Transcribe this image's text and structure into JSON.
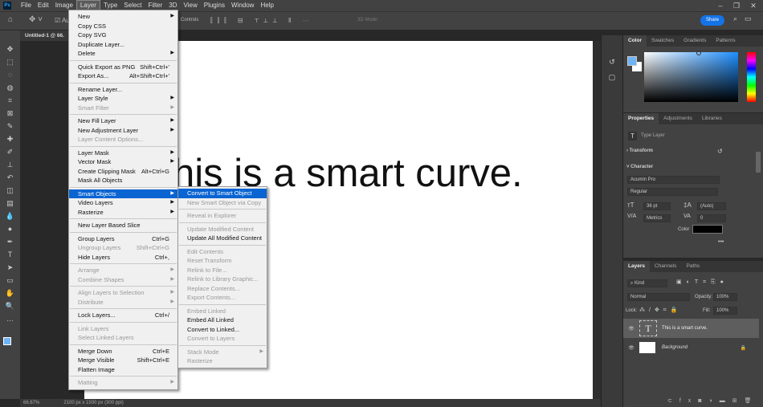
{
  "menubar": {
    "logo": "Ps",
    "items": [
      "File",
      "Edit",
      "Image",
      "Layer",
      "Type",
      "Select",
      "Filter",
      "3D",
      "View",
      "Plugins",
      "Window",
      "Help"
    ],
    "active": "Layer"
  },
  "options": {
    "auto_label": "Au",
    "controls_label": "Controls",
    "mode_label": "3D Mode:"
  },
  "share_label": "Share",
  "document": {
    "tab": "Untitled-1 @ 66.",
    "canvas_text": "his is a smart curve.",
    "zoom": "66.67%",
    "size": "2100 px x 1500 px (300 ppi)"
  },
  "toolbar_icons": [
    "move-icon",
    "marquee-icon",
    "lasso-icon",
    "quick-select-icon",
    "crop-icon",
    "frame-icon",
    "eyedropper-icon",
    "healing-icon",
    "brush-icon",
    "stamp-icon",
    "history-brush-icon",
    "eraser-icon",
    "gradient-icon",
    "blur-icon",
    "dodge-icon",
    "pen-icon",
    "type-icon",
    "path-select-icon",
    "shape-icon",
    "hand-icon",
    "zoom-icon",
    "more-icon"
  ],
  "toolbar_glyphs": [
    "✥",
    "⬚",
    "◌",
    "◍",
    "⌗",
    "⊠",
    "✎",
    "✚",
    "✐",
    "⊥",
    "↶",
    "◫",
    "▤",
    "💧",
    "●",
    "✒",
    "T",
    "➤",
    "▭",
    "✋",
    "🔍",
    "…"
  ],
  "layer_menu": [
    {
      "label": "New",
      "arrow": true
    },
    {
      "label": "Copy CSS"
    },
    {
      "label": "Copy SVG"
    },
    {
      "label": "Duplicate Layer..."
    },
    {
      "label": "Delete",
      "arrow": true
    },
    {
      "sep": true
    },
    {
      "label": "Quick Export as PNG",
      "shortcut": "Shift+Ctrl+'"
    },
    {
      "label": "Export As...",
      "shortcut": "Alt+Shift+Ctrl+'"
    },
    {
      "sep": true
    },
    {
      "label": "Rename Layer..."
    },
    {
      "label": "Layer Style",
      "arrow": true
    },
    {
      "label": "Smart Filter",
      "arrow": true,
      "disabled": true
    },
    {
      "sep": true
    },
    {
      "label": "New Fill Layer",
      "arrow": true
    },
    {
      "label": "New Adjustment Layer",
      "arrow": true
    },
    {
      "label": "Layer Content Options...",
      "disabled": true
    },
    {
      "sep": true
    },
    {
      "label": "Layer Mask",
      "arrow": true
    },
    {
      "label": "Vector Mask",
      "arrow": true
    },
    {
      "label": "Create Clipping Mask",
      "shortcut": "Alt+Ctrl+G"
    },
    {
      "label": "Mask All Objects"
    },
    {
      "sep": true
    },
    {
      "label": "Smart Objects",
      "arrow": true,
      "highlighted": true
    },
    {
      "label": "Video Layers",
      "arrow": true
    },
    {
      "label": "Rasterize",
      "arrow": true
    },
    {
      "sep": true
    },
    {
      "label": "New Layer Based Slice"
    },
    {
      "sep": true
    },
    {
      "label": "Group Layers",
      "shortcut": "Ctrl+G"
    },
    {
      "label": "Ungroup Layers",
      "shortcut": "Shift+Ctrl+G",
      "disabled": true
    },
    {
      "label": "Hide Layers",
      "shortcut": "Ctrl+,"
    },
    {
      "sep": true
    },
    {
      "label": "Arrange",
      "arrow": true,
      "disabled": true
    },
    {
      "label": "Combine Shapes",
      "arrow": true,
      "disabled": true
    },
    {
      "sep": true
    },
    {
      "label": "Align Layers to Selection",
      "arrow": true,
      "disabled": true
    },
    {
      "label": "Distribute",
      "arrow": true,
      "disabled": true
    },
    {
      "sep": true
    },
    {
      "label": "Lock Layers...",
      "shortcut": "Ctrl+/"
    },
    {
      "sep": true
    },
    {
      "label": "Link Layers",
      "disabled": true
    },
    {
      "label": "Select Linked Layers",
      "disabled": true
    },
    {
      "sep": true
    },
    {
      "label": "Merge Down",
      "shortcut": "Ctrl+E"
    },
    {
      "label": "Merge Visible",
      "shortcut": "Shift+Ctrl+E"
    },
    {
      "label": "Flatten Image"
    },
    {
      "sep": true
    },
    {
      "label": "Matting",
      "arrow": true,
      "disabled": true
    }
  ],
  "smart_objects_menu": [
    {
      "label": "Convert to Smart Object",
      "highlighted": true
    },
    {
      "label": "New Smart Object via Copy",
      "disabled": true
    },
    {
      "sep": true
    },
    {
      "label": "Reveal in Explorer",
      "disabled": true
    },
    {
      "sep": true
    },
    {
      "label": "Update Modified Content",
      "disabled": true
    },
    {
      "label": "Update All Modified Content"
    },
    {
      "sep": true
    },
    {
      "label": "Edit Contents",
      "disabled": true
    },
    {
      "label": "Reset Transform",
      "disabled": true
    },
    {
      "label": "Relink to File...",
      "disabled": true
    },
    {
      "label": "Relink to Library Graphic...",
      "disabled": true
    },
    {
      "label": "Replace Contents...",
      "disabled": true
    },
    {
      "label": "Export Contents...",
      "disabled": true
    },
    {
      "sep": true
    },
    {
      "label": "Embed Linked",
      "disabled": true
    },
    {
      "label": "Embed All Linked"
    },
    {
      "label": "Convert to Linked..."
    },
    {
      "label": "Convert to Layers",
      "disabled": true
    },
    {
      "sep": true
    },
    {
      "label": "Stack Mode",
      "arrow": true,
      "disabled": true
    },
    {
      "label": "Rasterize",
      "disabled": true
    }
  ],
  "color_panel": {
    "tabs": [
      "Color",
      "Swatches",
      "Gradients",
      "Patterns"
    ],
    "foreground": "#6fb4f5",
    "background": "#ffffff"
  },
  "properties": {
    "tabs": [
      "Properties",
      "Adjustments",
      "Libraries"
    ],
    "kind": "Type Layer",
    "transform": "Transform",
    "character": "Character",
    "font": "Acumin Pro",
    "style": "Regular",
    "size": "36 pt",
    "leading": "(Auto)",
    "kerning": "Metrics",
    "tracking": "0",
    "color_label": "Color",
    "color": "#000000"
  },
  "layers": {
    "tabs": [
      "Layers",
      "Channels",
      "Paths"
    ],
    "filter": "Kind",
    "blend": "Normal",
    "opacity_label": "Opacity:",
    "opacity": "100%",
    "lock_label": "Lock:",
    "fill_label": "Fill:",
    "fill": "100%",
    "items": [
      {
        "name": "This is a smart curve.",
        "type": "text",
        "selected": true
      },
      {
        "name": "Background",
        "type": "image",
        "locked": true
      }
    ]
  }
}
